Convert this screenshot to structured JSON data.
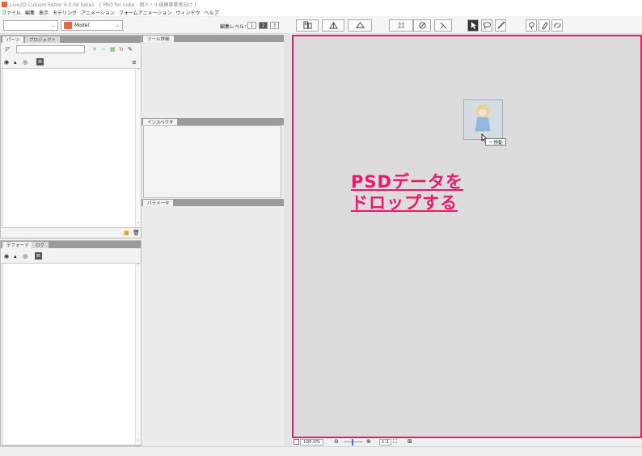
{
  "window": {
    "title": "Live2D Cubism Editor 4.0.06 beta1　[ PRO for indie - 個人・小規模事業者向け ]"
  },
  "menu": {
    "items": [
      "ファイル",
      "編集",
      "表示",
      "モデリング",
      "アニメーション",
      "フォームアニメーション",
      "ウィンドウ",
      "ヘルプ"
    ]
  },
  "toolbar": {
    "model_label": "Model",
    "edit_level_label": "編集レベル：",
    "levels": [
      "1",
      "2",
      "3"
    ],
    "active_level": "2"
  },
  "parts_panel": {
    "tabs": [
      "パーツ",
      "プロジェクト"
    ],
    "active_tab": "パーツ"
  },
  "deformer_panel": {
    "tabs": [
      "デフォーマ",
      "ログ"
    ],
    "active_tab": "デフォーマ"
  },
  "tool_detail_panel": {
    "tab": "ツール詳細"
  },
  "inspector_panel": {
    "tab": "インスペクタ"
  },
  "parameter_panel": {
    "tab": "パラメータ"
  },
  "canvas": {
    "drop_line1": "PSDデータを",
    "drop_line2": "ドロップする",
    "move_label": "移動",
    "highlight_color": "#e8196a"
  },
  "statusbar": {
    "zoom": "100.0%",
    "ratio": "1:1"
  }
}
